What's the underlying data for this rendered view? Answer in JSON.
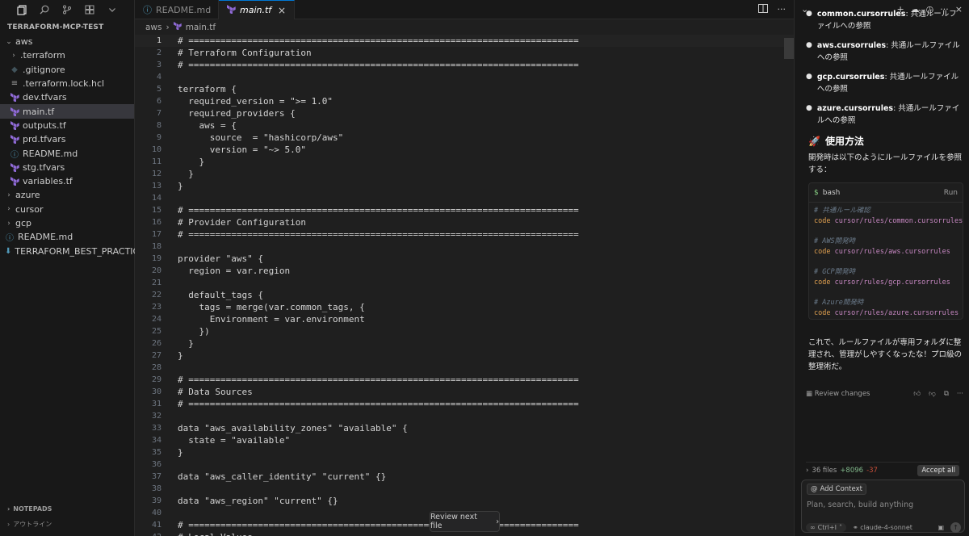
{
  "sidebar": {
    "project_title": "TERRAFORM-MCP-TEST",
    "tree": [
      {
        "label": "aws",
        "kind": "folder-open",
        "depth": 0
      },
      {
        "label": ".terraform",
        "kind": "folder",
        "depth": 1
      },
      {
        "label": ".gitignore",
        "kind": "git",
        "depth": 1
      },
      {
        "label": ".terraform.lock.hcl",
        "kind": "lines",
        "depth": 1
      },
      {
        "label": "dev.tfvars",
        "kind": "tf",
        "depth": 1
      },
      {
        "label": "main.tf",
        "kind": "tf",
        "depth": 1,
        "selected": true
      },
      {
        "label": "outputs.tf",
        "kind": "tf",
        "depth": 1
      },
      {
        "label": "prd.tfvars",
        "kind": "tf",
        "depth": 1
      },
      {
        "label": "README.md",
        "kind": "info",
        "depth": 1
      },
      {
        "label": "stg.tfvars",
        "kind": "tf",
        "depth": 1
      },
      {
        "label": "variables.tf",
        "kind": "tf",
        "depth": 1
      },
      {
        "label": "azure",
        "kind": "folder",
        "depth": 0
      },
      {
        "label": "cursor",
        "kind": "folder",
        "depth": 0
      },
      {
        "label": "gcp",
        "kind": "folder",
        "depth": 0
      },
      {
        "label": "README.md",
        "kind": "info",
        "depth": 0
      },
      {
        "label": "TERRAFORM_BEST_PRACTICES...",
        "kind": "download",
        "depth": 0
      }
    ],
    "notepads": "NOTEPADS",
    "outline": "アウトライン"
  },
  "editor": {
    "tabs": [
      {
        "label": "README.md",
        "active": false
      },
      {
        "label": "main.tf",
        "active": true
      }
    ],
    "breadcrumb": [
      "aws",
      "main.tf"
    ],
    "current_line": 1,
    "lines": [
      "# =========================================================================",
      "# Terraform Configuration",
      "# =========================================================================",
      "",
      "terraform {",
      "  required_version = \">= 1.0\"",
      "  required_providers {",
      "    aws = {",
      "      source  = \"hashicorp/aws\"",
      "      version = \"~> 5.0\"",
      "    }",
      "  }",
      "}",
      "",
      "# =========================================================================",
      "# Provider Configuration",
      "# =========================================================================",
      "",
      "provider \"aws\" {",
      "  region = var.region",
      "",
      "  default_tags {",
      "    tags = merge(var.common_tags, {",
      "      Environment = var.environment",
      "    })",
      "  }",
      "}",
      "",
      "# =========================================================================",
      "# Data Sources",
      "# =========================================================================",
      "",
      "data \"aws_availability_zones\" \"available\" {",
      "  state = \"available\"",
      "}",
      "",
      "data \"aws_caller_identity\" \"current\" {}",
      "",
      "data \"aws_region\" \"current\" {}",
      "",
      "# =========================================================================",
      "# Local Values"
    ],
    "review_next_file": "Review next file"
  },
  "chat": {
    "bullets": [
      {
        "key": "common.cursorrules",
        "text": ": 共通ルールファイルへの参照"
      },
      {
        "key": "aws.cursorrules",
        "text": ": 共通ルールファイルへの参照"
      },
      {
        "key": "gcp.cursorrules",
        "text": ": 共通ルールファイルへの参照"
      },
      {
        "key": "azure.cursorrules",
        "text": ": 共通ルールファイルへの参照"
      }
    ],
    "section_emoji": "🚀",
    "section_title": "使用方法",
    "description": "開発時は以下のようにルールファイルを参照する：",
    "code_lang": "bash",
    "code_run": "Run",
    "code_blocks": [
      {
        "comment": "# 共通ルール確認",
        "cmd": "code",
        "path": "cursor/rules/common.cursorrules"
      },
      {
        "comment": "# AWS開発時",
        "cmd": "code",
        "path": "cursor/rules/aws.cursorrules"
      },
      {
        "comment": "# GCP開発時",
        "cmd": "code",
        "path": "cursor/rules/gcp.cursorrules"
      },
      {
        "comment": "# Azure開発時",
        "cmd": "code",
        "path": "cursor/rules/azure.cursorrules"
      }
    ],
    "conclusion": "これで、ルールファイルが専用フォルダに整理され、管理がしやすくなったな！プロ級の整理術だ。",
    "review_changes": "Review changes",
    "files_count": "36 files",
    "additions": "+8096",
    "deletions": "-37",
    "accept_all": "Accept all",
    "add_context": "Add Context",
    "placeholder": "Plan, search, build anything",
    "mode": "Ctrl+I",
    "model": "claude-4-sonnet"
  }
}
